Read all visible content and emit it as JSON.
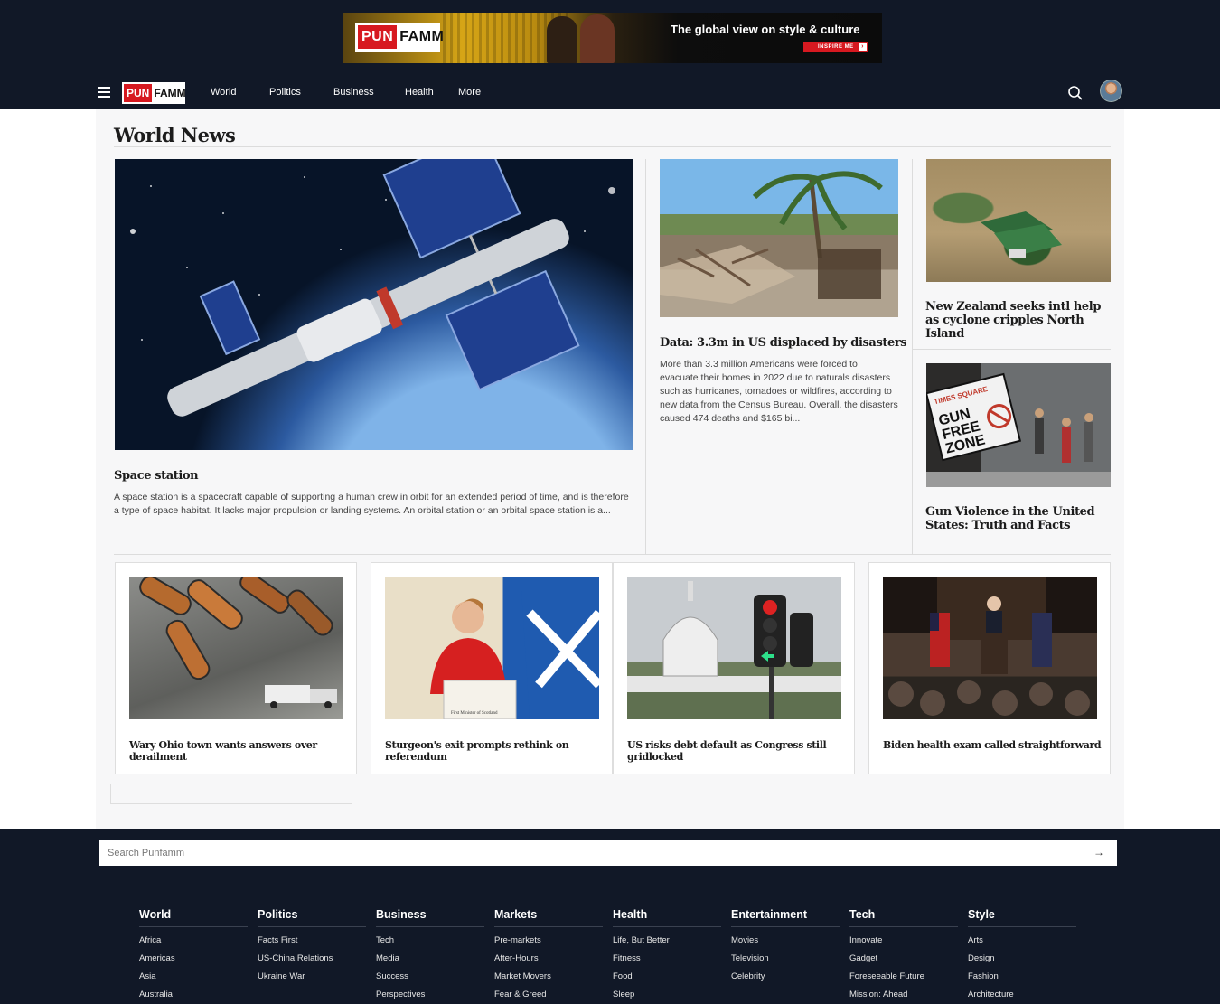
{
  "ad": {
    "logo_red": "PUN",
    "logo_black": "FAMM",
    "tagline": "The global view on style & culture",
    "button": "INSPIRE ME"
  },
  "nav": {
    "logo_red": "PUN",
    "logo_black": "FAMM",
    "links": [
      "World",
      "Politics",
      "Business",
      "Health",
      "More"
    ]
  },
  "main": {
    "heading": "World News",
    "lead": {
      "title": "Space station",
      "body": "A space station is a spacecraft capable of supporting a human crew in orbit for an extended period of time, and is therefore a type of space habitat. It lacks major propulsion or landing systems. An orbital station or an orbital space station is a..."
    },
    "second": {
      "title": "Data: 3.3m in US displaced by disasters",
      "body": "More than 3.3 million Americans were forced to evacuate their homes in 2022 due to naturals disasters such as hurricanes, tornadoes or wildfires, according to new data from the Census Bureau. Overall, the disasters caused 474 deaths and $165 bi..."
    },
    "side": [
      {
        "title": "New Zealand seeks intl help as cyclone cripples North Island"
      },
      {
        "title": "Gun Violence in the United States: Truth and Facts",
        "sign": "GUN FREE ZONE",
        "sign_top": "TIMES SQUARE"
      }
    ],
    "cards": [
      {
        "title": "Wary Ohio town wants answers over derailment"
      },
      {
        "title": "Sturgeon's exit prompts rethink on referendum",
        "podium": "First Minister of Scotland"
      },
      {
        "title": "US risks debt default as Congress still gridlocked"
      },
      {
        "title": "Biden health exam called straightforward"
      }
    ]
  },
  "footer": {
    "search_placeholder": "Search Punfamm",
    "columns": [
      {
        "heading": "World",
        "items": [
          "Africa",
          "Americas",
          "Asia",
          "Australia"
        ]
      },
      {
        "heading": "Politics",
        "items": [
          "Facts First",
          "US-China Relations",
          "Ukraine War"
        ]
      },
      {
        "heading": "Business",
        "items": [
          "Tech",
          "Media",
          "Success",
          "Perspectives"
        ]
      },
      {
        "heading": "Markets",
        "items": [
          "Pre-markets",
          "After-Hours",
          "Market Movers",
          "Fear & Greed"
        ]
      },
      {
        "heading": "Health",
        "items": [
          "Life, But Better",
          "Fitness",
          "Food",
          "Sleep"
        ]
      },
      {
        "heading": "Entertainment",
        "items": [
          "Movies",
          "Television",
          "Celebrity"
        ]
      },
      {
        "heading": "Tech",
        "items": [
          "Innovate",
          "Gadget",
          "Foreseeable Future",
          "Mission: Ahead"
        ]
      },
      {
        "heading": "Style",
        "items": [
          "Arts",
          "Design",
          "Fashion",
          "Architecture"
        ]
      }
    ]
  },
  "colors": {
    "header_bg": "#111827",
    "brand_red": "#d71920",
    "page_bg": "#f7f7f8"
  },
  "icons": [
    "menu-icon",
    "search-icon",
    "avatar",
    "arrow-right-icon"
  ]
}
